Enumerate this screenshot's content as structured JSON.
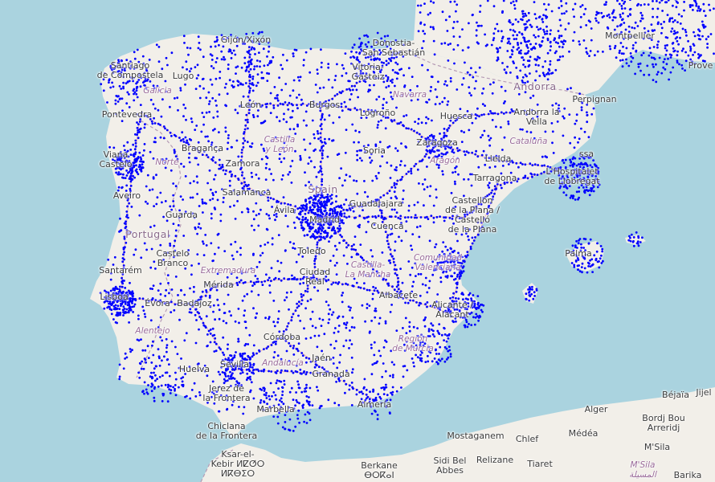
{
  "map": {
    "colors": {
      "sea": "#aad3df",
      "land": "#f2efe9",
      "road_major": "#e8a0a0",
      "road_minor": "#d9b7b7",
      "border": "#b59bb5",
      "marker": "#0000ff"
    },
    "icons": {
      "marker": "dot-marker-icon"
    },
    "labels": {
      "gijon": "Gijón/Xixón",
      "donostia": "Donostia-\nSan Sebastián",
      "santiago": "Santiago\nde Compostela",
      "lugo": "Lugo",
      "galicia": "Galicia",
      "pontevedra": "Pontevedra",
      "leon": "León",
      "burgos": "Burgos",
      "vitoria": "Vitoria-\nGasteiz",
      "navarra": "Navarra",
      "logrono": "Logroño",
      "huesca": "Huesca",
      "andorra": "Andorra",
      "andorra_vella": "Andorra la\nVella",
      "perpignan": "Perpignan",
      "montpellier": "Montpellier",
      "provence": "Prove",
      "braganca": "Bragança",
      "castilla_leon": "Castilla\ny León",
      "soria": "Soria",
      "zaragoza": "Zaragoza",
      "aragon": "Aragón",
      "catalunya": "Cataluña",
      "lleida": "Lleida",
      "tarragona": "Tarragona",
      "hospitalet": "L'Hospitalet\nde Llobregat",
      "massa": "ssa",
      "viana": "Viana\nCastelo",
      "norte": "Norte",
      "zamora": "Zamora",
      "aveiro": "Aveiro",
      "salamanca": "Salamanca",
      "spain": "Spain",
      "guadalajara": "Guadalajara",
      "castellon": "Castellón\nde la Plana /\nCastelló\nde la Plana",
      "guarda": "Guarda",
      "avila": "Ávila",
      "madrid": "Madrid",
      "cuenca": "Cuenca",
      "portugal": "Portugal",
      "castelo_branco": "Castelo\nBranco",
      "extremadura": "Extremadura",
      "toledo": "Toledo",
      "comunidad_valenciana": "Comunidad\nValenciana",
      "palma": "Palma",
      "santarem": "Santarém",
      "merida": "Mérida",
      "ciudad_real": "Ciudad\nReal",
      "castilla_mancha": "Castilla-\nLa Mancha",
      "lisboa": "Lisboa",
      "evora": "Évora",
      "badajoz": "Badajoz",
      "albacete": "Albacete",
      "alicante": "Alicante /\nAlacant",
      "alentejo": "Alentejo",
      "cordoba": "Córdoba",
      "murcia": "Región\nde Murcia",
      "jaen": "Jaén",
      "huelva": "Huelva",
      "sevilla": "Sevilla",
      "andalucia": "Andalucía",
      "granada": "Granada",
      "jerez": "Jerez de\nla Frontera",
      "marbella": "Marbella",
      "almeria": "Almería",
      "chiclana": "Chiclana\nde la Frontera",
      "bejaia": "Béjaïa",
      "jijel": "Jijel",
      "alger": "Alger",
      "bordj": "Bordj Bou\nArreridj",
      "mostaganem": "Mostaganem",
      "chlef": "Chlef",
      "medea": "Médéa",
      "msila": "M'Sila",
      "ksar": "Ksar-el-\nKebir ⵍⵇⵚⵔ\nⵍⴽⴱⵉⵔ",
      "berkane": "Berkane\nⴱⵔⴽⴰⵏ",
      "sidi_bel": "Sidi Bel\nAbbes",
      "relizane": "Relizane",
      "tiaret": "Tiaret",
      "msila_ar": "M'Sila\nالمسيلة",
      "barika": "Barika"
    }
  }
}
